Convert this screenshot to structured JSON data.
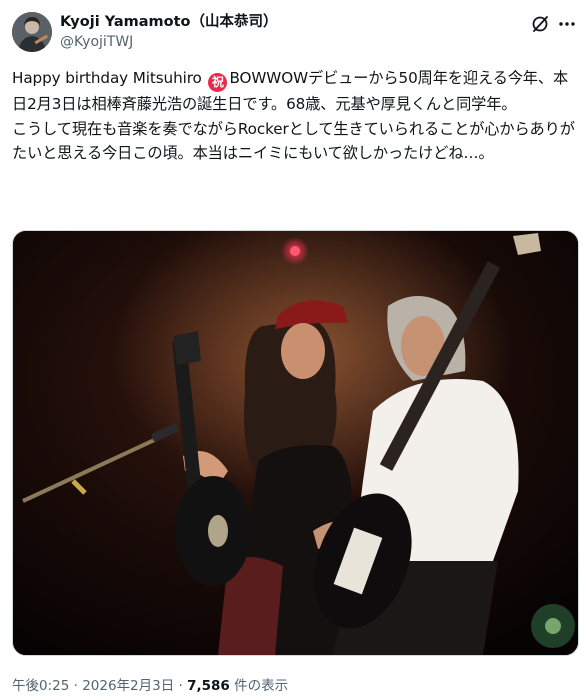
{
  "author": {
    "name": "Kyoji Yamamoto（山本恭司）",
    "handle": "@KyojiTWJ"
  },
  "icons": {
    "avatar": "avatar",
    "grok": "grok-slash-circle-icon",
    "more": "more-dots-icon",
    "celebration_emoji": "iwai-emoji-icon"
  },
  "tweet": {
    "line1_prefix": "Happy birthday Mitsuhiro ",
    "emoji_text": "祝",
    "line1_rest": "BOWWOWデビューから50周年を迎える今年、本日2月3日は相棒斉藤光浩の誕生日です。68歳、元基や厚見くんと同学年。",
    "line2": "こうして現在も音楽を奏でながらRockerとして生きていられることが心からありがたいと思える今日この頃。本当はニイミにもいて欲しかったけどね…。"
  },
  "photo": {
    "alt": "ステージでギターを弾く二人のギタリスト"
  },
  "meta": {
    "time": "午後0:25",
    "sep1": " · ",
    "date": "2026年2月3日",
    "sep2": " · ",
    "views_count": "7,586",
    "views_label": " 件の表示"
  },
  "colors": {
    "text": "#0f1419",
    "secondary": "#536471",
    "emoji_red": "#e8294a",
    "border": "#cfd9de"
  }
}
